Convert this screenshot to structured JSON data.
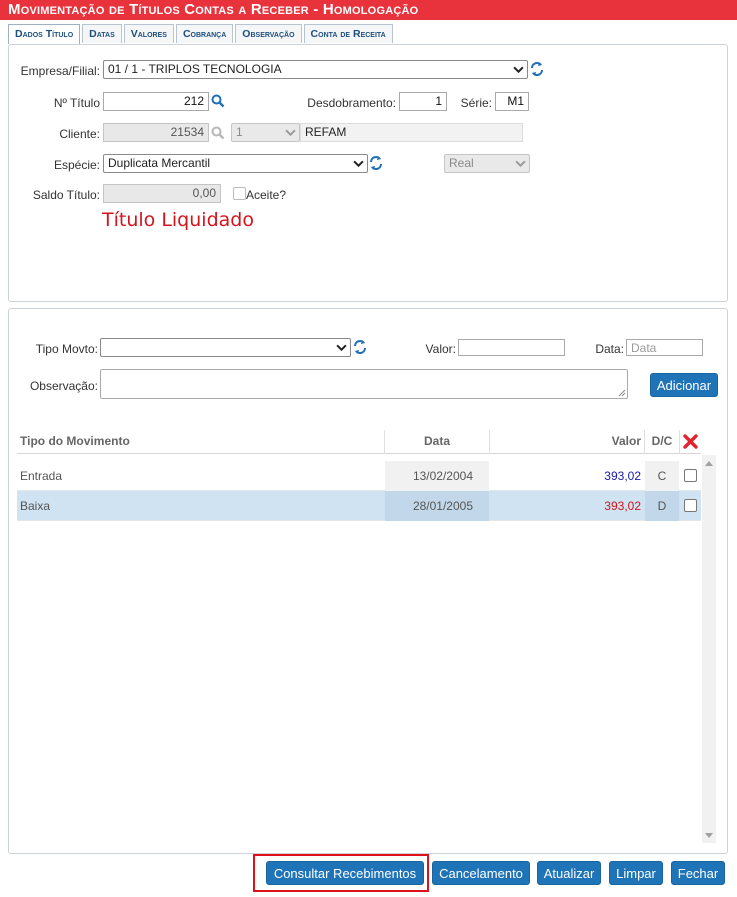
{
  "window": {
    "title": "Movimentação de Títulos Contas a Receber  - Homologação"
  },
  "tabs": [
    {
      "label": "Dados Título"
    },
    {
      "label": "Datas"
    },
    {
      "label": "Valores"
    },
    {
      "label": "Cobrança"
    },
    {
      "label": "Observação"
    },
    {
      "label": "Conta de Receita"
    }
  ],
  "form": {
    "empresa_label": "Empresa/Filial:",
    "empresa_value": "01 / 1 - TRIPLOS TECNOLOGIA",
    "titulo_label": "Nº Título",
    "titulo_value": "212",
    "desdobramento_label": "Desdobramento:",
    "desdobramento_value": "1",
    "serie_label": "Série:",
    "serie_value": "M1",
    "cliente_label": "Cliente:",
    "cliente_code": "21534",
    "cliente_seq": "1",
    "cliente_name": "REFAM",
    "especie_label": "Espécie:",
    "especie_value": "Duplicata Mercantil",
    "moeda_value": "Real",
    "saldo_label": "Saldo Título:",
    "saldo_value": "0,00",
    "aceite_label": "Aceite?",
    "status_text": "Título Liquidado"
  },
  "movto": {
    "tipo_label": "Tipo Movto:",
    "tipo_value": "",
    "valor_label": "Valor:",
    "valor_value": "",
    "data_label": "Data:",
    "data_placeholder": "Data",
    "obs_label": "Observação:",
    "add_label": "Adicionar"
  },
  "grid": {
    "columns": {
      "tipo": "Tipo do Movimento",
      "data": "Data",
      "valor": "Valor",
      "dc": "D/C"
    },
    "rows": [
      {
        "tipo": "Entrada",
        "data": "13/02/2004",
        "valor": "393,02",
        "dc": "C"
      },
      {
        "tipo": "Baixa",
        "data": "28/01/2005",
        "valor": "393,02",
        "dc": "D"
      }
    ]
  },
  "footer": {
    "consultar": "Consultar Recebimentos",
    "cancelamento": "Cancelamento",
    "atualizar": "Atualizar",
    "limpar": "Limpar",
    "fechar": "Fechar"
  },
  "colors": {
    "title_bar": "#e8323c",
    "button": "#1f73b7",
    "credit_value": "#1a1aa8",
    "debit_value": "#d3141c",
    "selected_row": "#cfe3f3"
  }
}
